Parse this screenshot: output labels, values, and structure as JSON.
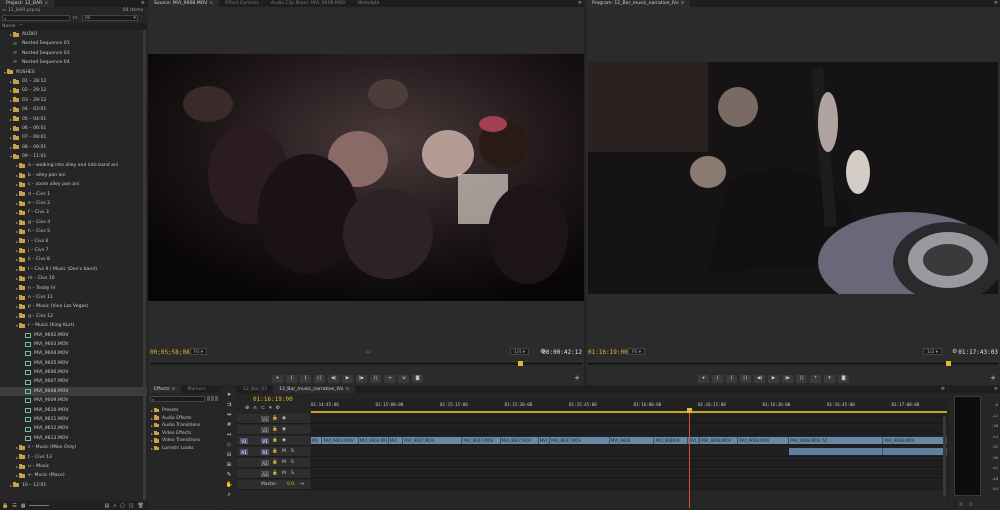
{
  "project": {
    "tab": "Project: 12_BAR",
    "file": "12_BAR.prproj",
    "item_count": "84 Items",
    "in_label": "In:",
    "in_value": "All",
    "column_name": "Name",
    "tree": [
      {
        "label": "AUDIO",
        "kind": "folder",
        "indent": 1,
        "open": false
      },
      {
        "label": "Nested Sequence 01",
        "kind": "seq",
        "indent": 1
      },
      {
        "label": "Nested Sequence 03",
        "kind": "seq",
        "indent": 1
      },
      {
        "label": "Nested Sequence 04",
        "kind": "seq",
        "indent": 1
      },
      {
        "label": "RUSHES",
        "kind": "folder",
        "indent": 0,
        "open": true
      },
      {
        "label": "01 – 28:12",
        "kind": "folder",
        "indent": 1
      },
      {
        "label": "02 – 29:12",
        "kind": "folder",
        "indent": 1
      },
      {
        "label": "03 – 29:12",
        "kind": "folder",
        "indent": 1
      },
      {
        "label": "04 – 03:01",
        "kind": "folder",
        "indent": 1
      },
      {
        "label": "05 – 04:01",
        "kind": "folder",
        "indent": 1
      },
      {
        "label": "06 – 06:01",
        "kind": "folder",
        "indent": 1
      },
      {
        "label": "07 – 09:01",
        "kind": "folder",
        "indent": 1
      },
      {
        "label": "08 – 09:01",
        "kind": "folder",
        "indent": 1
      },
      {
        "label": "09 – 11:01",
        "kind": "folder",
        "indent": 1,
        "open": true
      },
      {
        "label": "a – walking into alley and into band ani",
        "kind": "folder",
        "indent": 2
      },
      {
        "label": "b – alley pan ani",
        "kind": "folder",
        "indent": 2
      },
      {
        "label": "c – zoom alley pan ani",
        "kind": "folder",
        "indent": 2
      },
      {
        "label": "d – Civs 1",
        "kind": "folder",
        "indent": 2
      },
      {
        "label": "e – Civs 2",
        "kind": "folder",
        "indent": 2
      },
      {
        "label": "f – Civs 3",
        "kind": "folder",
        "indent": 2
      },
      {
        "label": "g – Civs 4",
        "kind": "folder",
        "indent": 2
      },
      {
        "label": "h – Civs 5",
        "kind": "folder",
        "indent": 2
      },
      {
        "label": "i – Civs 6",
        "kind": "folder",
        "indent": 2
      },
      {
        "label": "j – Civs 7",
        "kind": "folder",
        "indent": 2
      },
      {
        "label": "k – Civs 8",
        "kind": "folder",
        "indent": 2
      },
      {
        "label": "l – Civs 9 / Music (Dan's band)",
        "kind": "folder",
        "indent": 2
      },
      {
        "label": "m – Civs 10",
        "kind": "folder",
        "indent": 2
      },
      {
        "label": "n – Teddy IV",
        "kind": "folder",
        "indent": 2
      },
      {
        "label": "o – Civs 11",
        "kind": "folder",
        "indent": 2
      },
      {
        "label": "p – Music (Viva Las Vegas)",
        "kind": "folder",
        "indent": 2
      },
      {
        "label": "q – Civs 12",
        "kind": "folder",
        "indent": 2
      },
      {
        "label": "r – Music (King Kurt)",
        "kind": "folder",
        "indent": 2,
        "open": true
      },
      {
        "label": "MVI_9602.MOV",
        "kind": "clip",
        "indent": 3
      },
      {
        "label": "MVI_9603.MOV",
        "kind": "clip",
        "indent": 3
      },
      {
        "label": "MVI_9604.MOV",
        "kind": "clip",
        "indent": 3
      },
      {
        "label": "MVI_9605.MOV",
        "kind": "clip",
        "indent": 3
      },
      {
        "label": "MVI_9606.MOV",
        "kind": "clip",
        "indent": 3
      },
      {
        "label": "MVI_9607.MOV",
        "kind": "clip",
        "indent": 3
      },
      {
        "label": "MVI_9608.MOV",
        "kind": "clip",
        "indent": 3,
        "selected": true
      },
      {
        "label": "MVI_9609.MOV",
        "kind": "clip",
        "indent": 3
      },
      {
        "label": "MVI_9610.MOV",
        "kind": "clip",
        "indent": 3
      },
      {
        "label": "MVI_9611.MOV",
        "kind": "clip",
        "indent": 3
      },
      {
        "label": "MVI_9612.MOV",
        "kind": "clip",
        "indent": 3
      },
      {
        "label": "MVI_9613.MOV",
        "kind": "clip",
        "indent": 3
      },
      {
        "label": "s – Music (Mike Only)",
        "kind": "folder",
        "indent": 2
      },
      {
        "label": "t – Civs 13",
        "kind": "folder",
        "indent": 2
      },
      {
        "label": "u – Music",
        "kind": "folder",
        "indent": 2
      },
      {
        "label": "v– Music (Maco)",
        "kind": "folder",
        "indent": 2
      },
      {
        "label": "10 – 12:01",
        "kind": "folder",
        "indent": 1
      }
    ]
  },
  "source": {
    "tabs": [
      "Source: MVI_9608.MOV",
      "Effect Controls",
      "Audio Clip Mixer: MVI_9608.MOV",
      "Metadata"
    ],
    "timecode_in": "00;05;58;08",
    "fit": "Fit",
    "resolution": "1/4",
    "duration": "00:00:42:12"
  },
  "program": {
    "tab": "Program: 12_Bar_music_narrative_IVs",
    "timecode_in": "01:16:19:00",
    "fit": "Fit",
    "resolution": "1/2",
    "duration": "01:17:43:03"
  },
  "effects": {
    "tabs": [
      "Effects",
      "Markers"
    ],
    "items": [
      "Presets",
      "Audio Effects",
      "Audio Transitions",
      "Video Effects",
      "Video Transitions",
      "Lumetri Looks"
    ]
  },
  "timeline": {
    "tabs": [
      "12_Bar_02",
      "12_Bar_music_narrative_IVs"
    ],
    "timecode": "01:16:19:00",
    "ticks": [
      "01:14:45:00",
      "01:15:00:00",
      "01:15:15:00",
      "01:15:30:00",
      "01:15:45:00",
      "01:16:00:00",
      "01:16:15:00",
      "01:16:30:00",
      "01:16:45:00",
      "01:17:00:00"
    ],
    "video_tracks": [
      "V3",
      "V2",
      "V1"
    ],
    "audio_tracks": [
      "A1",
      "A2",
      "A3"
    ],
    "master_label": "Master",
    "master_value": "0.0",
    "v1_source_label": "V1",
    "a1_source_label": "A1",
    "clips": [
      {
        "label": "MV",
        "start": 0,
        "end": 0.018
      },
      {
        "label": "MVI_9604.MOV",
        "start": 0.018,
        "end": 0.075
      },
      {
        "label": "MVI_9603.MO",
        "start": 0.075,
        "end": 0.122
      },
      {
        "label": "MVI",
        "start": 0.122,
        "end": 0.145
      },
      {
        "label": "MVI_9607.MOV",
        "start": 0.145,
        "end": 0.238
      },
      {
        "label": "MVI_9607.MOV",
        "start": 0.238,
        "end": 0.298
      },
      {
        "label": "MVI_9607.MOV",
        "start": 0.298,
        "end": 0.358
      },
      {
        "label": "MVI_96",
        "start": 0.358,
        "end": 0.376
      },
      {
        "label": "MVI_9607.MOV",
        "start": 0.376,
        "end": 0.47
      },
      {
        "label": "MVI_9604",
        "start": 0.47,
        "end": 0.54
      },
      {
        "label": "MVI_9608.M",
        "start": 0.54,
        "end": 0.592
      },
      {
        "label": "MVI_9",
        "start": 0.592,
        "end": 0.612
      },
      {
        "label": "MVI_9608.MOV",
        "start": 0.612,
        "end": 0.672
      },
      {
        "label": "MVI_9608.MOV",
        "start": 0.672,
        "end": 0.752
      },
      {
        "label": "MVI_9608.MOV [V]",
        "start": 0.752,
        "end": 0.9
      },
      {
        "label": "MVI_9608.MOV",
        "start": 0.9,
        "end": 1.0
      }
    ],
    "playhead": 0.595
  },
  "meter": {
    "scale": [
      "-6",
      "-12",
      "-18",
      "-24",
      "-30",
      "-36",
      "-42",
      "-48",
      "-54"
    ]
  },
  "icons": {
    "play": "▶",
    "step_back": "◀|",
    "step_fwd": "|▶",
    "mark_in": "{",
    "mark_out": "}",
    "wrench": "🔧",
    "plus": "+"
  }
}
